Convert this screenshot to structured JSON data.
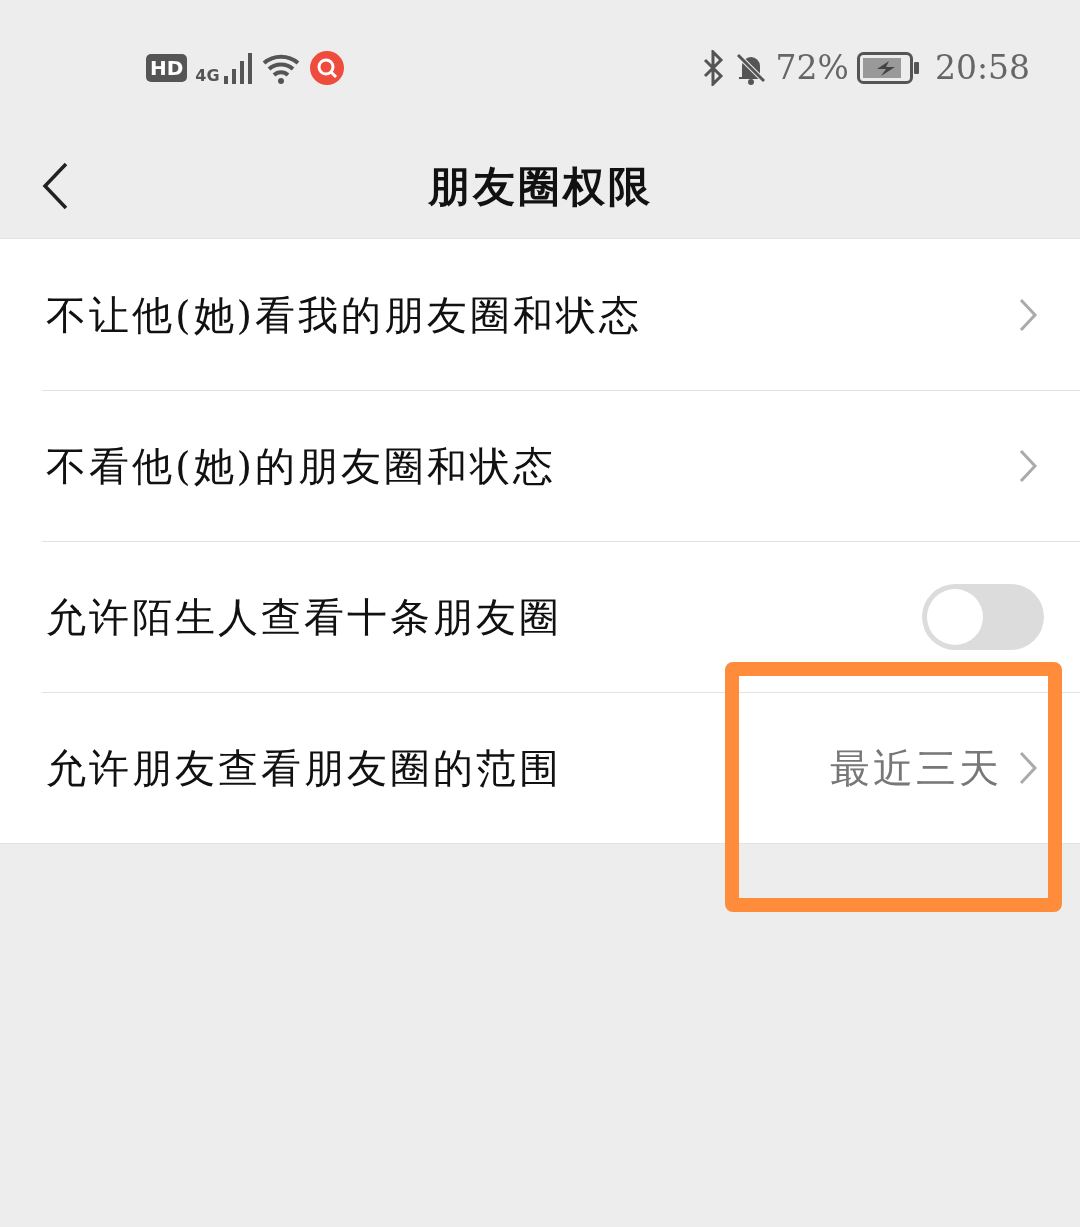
{
  "status_bar": {
    "hd": "HD",
    "network": "4G",
    "battery": "72%",
    "time": "20:58"
  },
  "header": {
    "title": "朋友圈权限"
  },
  "rows": [
    {
      "kind": "link",
      "label": "不让他(她)看我的朋友圈和状态"
    },
    {
      "kind": "link",
      "label": "不看他(她)的朋友圈和状态"
    },
    {
      "kind": "toggle",
      "label": "允许陌生人查看十条朋友圈",
      "on": false
    },
    {
      "kind": "link",
      "label": "允许朋友查看朋友圈的范围",
      "value": "最近三天"
    }
  ],
  "annotation": {
    "kind": "frame"
  }
}
